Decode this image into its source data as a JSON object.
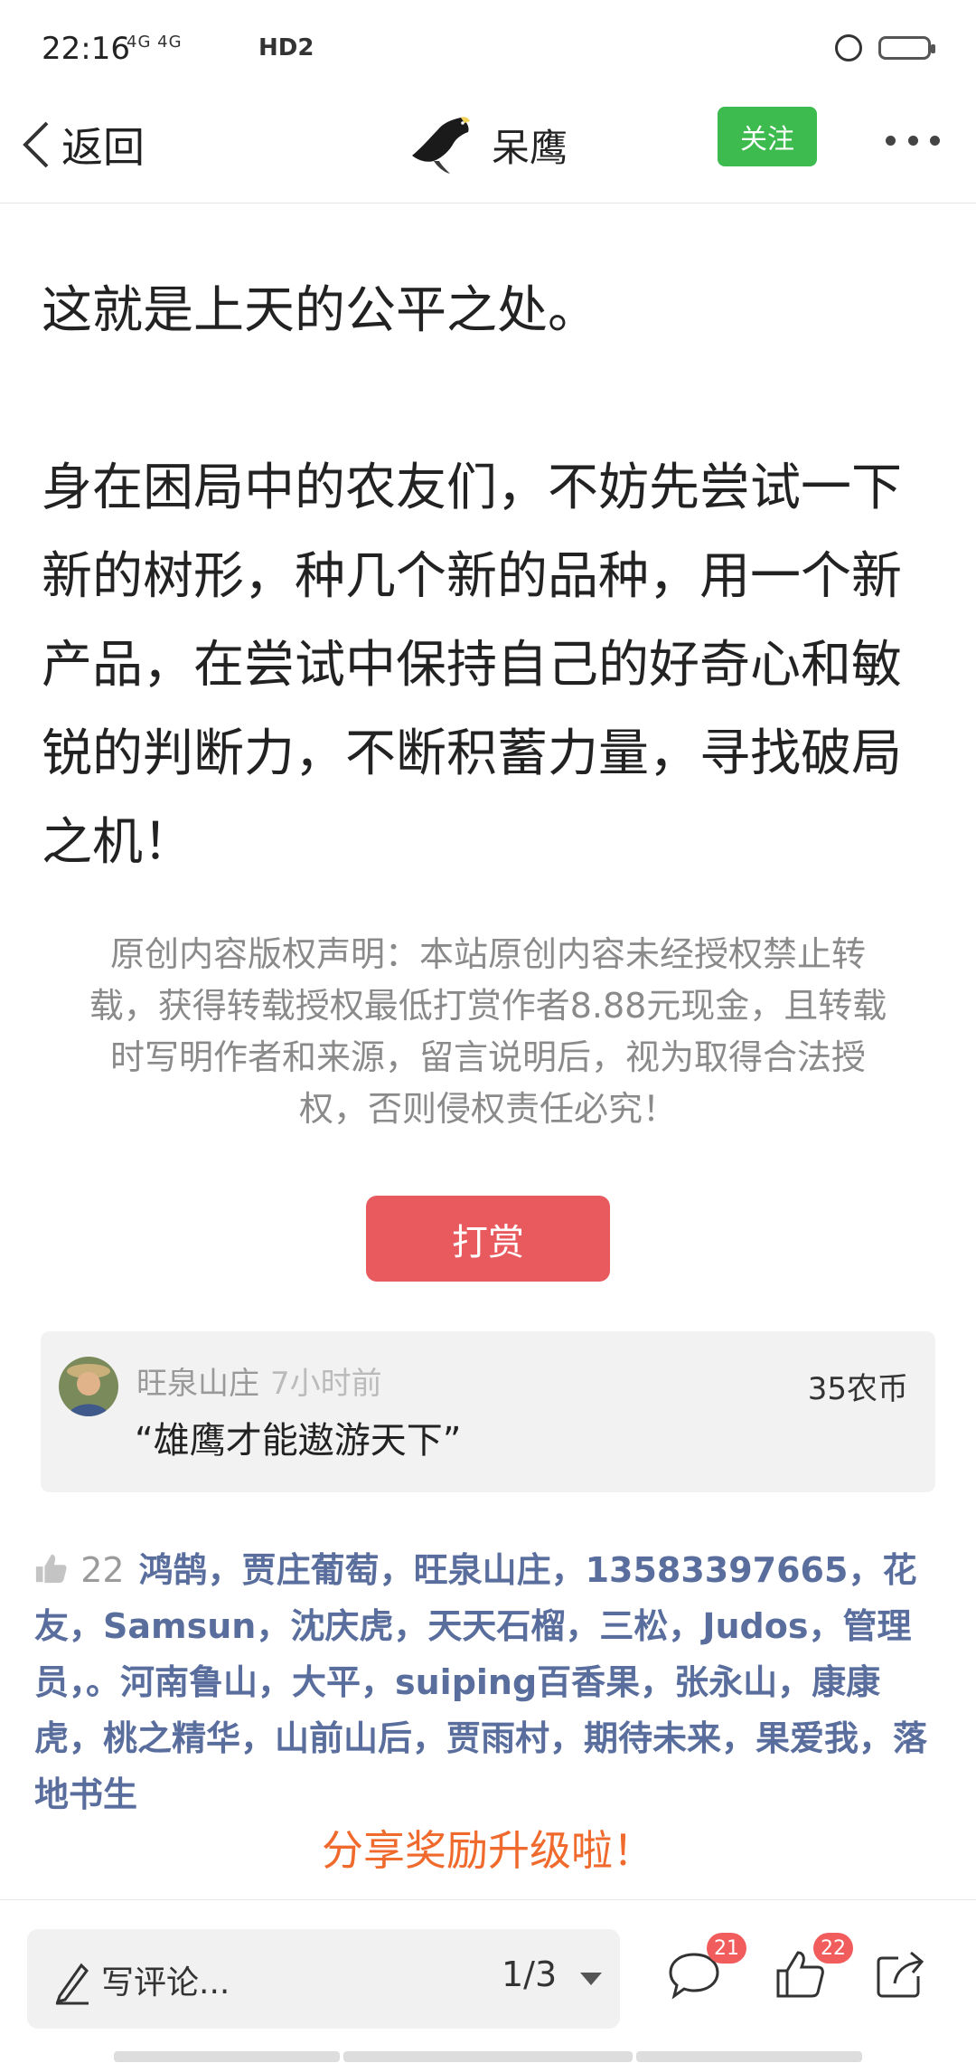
{
  "status": {
    "time": "22:16",
    "net": "4G 4G",
    "hd": "HD2"
  },
  "nav": {
    "back_label": "返回",
    "author": "呆鹰",
    "follow_label": "关注"
  },
  "article": {
    "paragraphs": [
      "这就是上天的公平之处。",
      "身在困局中的农友们，不妨先尝试一下新的树形，种几个新的品种，用一个新产品，在尝试中保持自己的好奇心和敏锐的判断力，不断积蓄力量，寻找破局之机！"
    ]
  },
  "copyright": "原创内容版权声明：本站原创内容未经授权禁止转载，获得转载授权最低打赏作者8.88元现金，且转载时写明作者和来源，留言说明后，视为取得合法授权，否则侵权责任必究！",
  "tip": {
    "button_label": "打赏",
    "name": "旺泉山庄",
    "time": "7小时前",
    "amount": "35农币",
    "message": "“雄鹰才能遨游天下”"
  },
  "likes": {
    "count": "22",
    "names": "鸿鹄，贾庄葡萄，旺泉山庄，13583397665，花友，Samsun，沈庆虎，天天石榴，三松，Judos，管理员，。河南鲁山，大平，suiping百香果，张永山，康康虎，桃之精华，山前山后，贾雨村，期待未来，果爱我，落地书生"
  },
  "share_promo": "分享奖励升级啦！",
  "bottom": {
    "comment_placeholder": "写评论...",
    "page_indicator": "1/3",
    "comments_badge": "21",
    "likes_badge": "22"
  },
  "icons": [
    "chevron-left-icon",
    "eagle-avatar-icon",
    "more-icon",
    "thumb-up-icon",
    "pencil-icon",
    "comment-bubble-icon",
    "share-icon"
  ],
  "colors": {
    "follow_green": "#3dbb4e",
    "tip_red": "#e85a5d",
    "link_blue": "#5a6e9e",
    "promo_orange": "#ef6a2c",
    "badge_red": "#f15c5c"
  }
}
